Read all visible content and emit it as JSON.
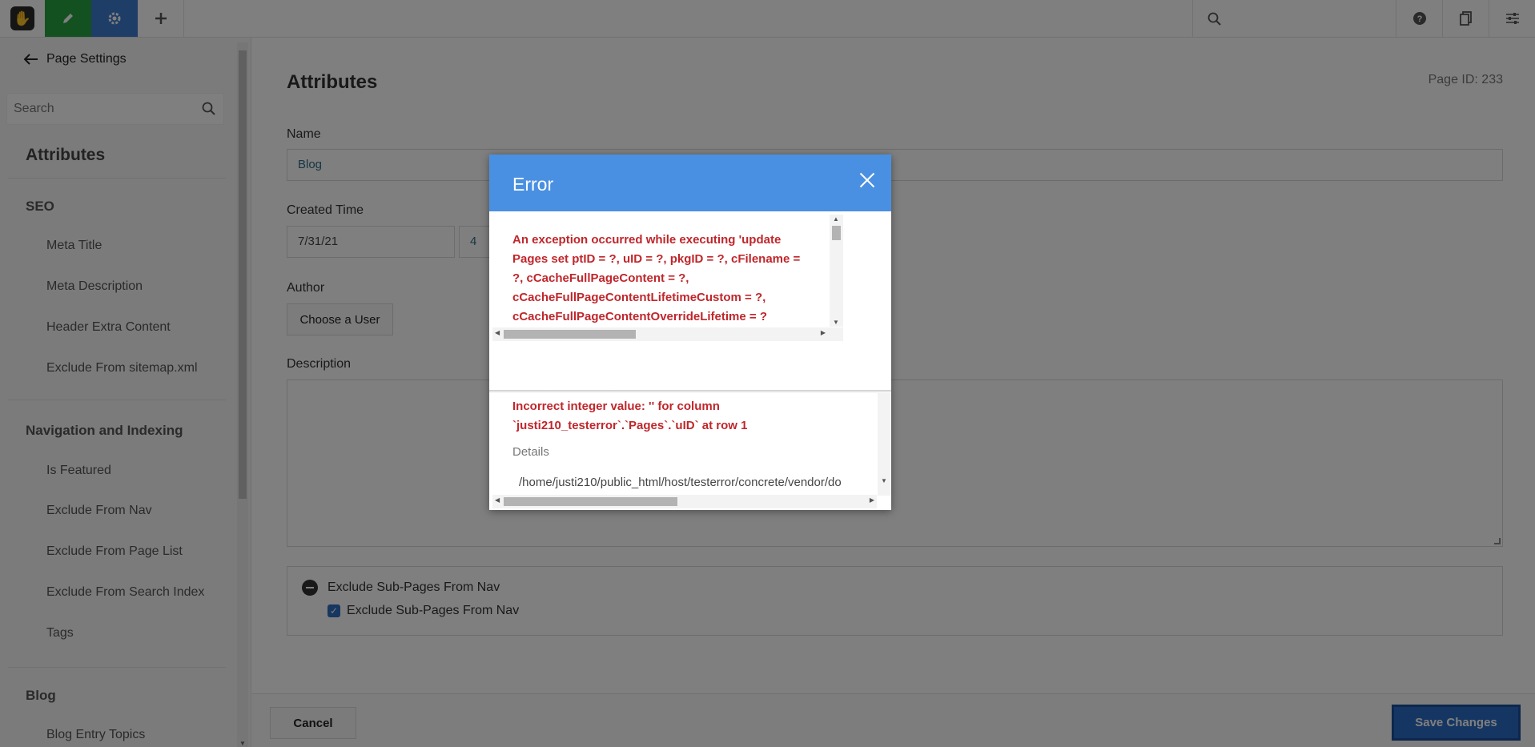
{
  "toolbar": {
    "search_placeholder": "",
    "icons": [
      "concrete-logo-icon",
      "pencil-icon",
      "gear-icon",
      "plus-icon",
      "search-icon",
      "help-icon",
      "pages-icon",
      "sliders-icon"
    ]
  },
  "sidebar": {
    "back_label": "Page Settings",
    "search_placeholder": "Search",
    "title": "Attributes",
    "groups": [
      {
        "label": "SEO",
        "items": [
          "Meta Title",
          "Meta Description",
          "Header Extra Content",
          "Exclude From sitemap.xml"
        ]
      },
      {
        "label": "Navigation and Indexing",
        "items": [
          "Is Featured",
          "Exclude From Nav",
          "Exclude From Page List",
          "Exclude From Search Index",
          "Tags"
        ]
      },
      {
        "label": "Blog",
        "items": [
          "Blog Entry Topics"
        ]
      }
    ]
  },
  "main": {
    "title": "Attributes",
    "page_id": "Page ID: 233",
    "name_label": "Name",
    "name_value": "Blog",
    "created_label": "Created Time",
    "created_date": "7/31/21",
    "created_hour": "4",
    "author_label": "Author",
    "author_button": "Choose a User",
    "description_label": "Description",
    "attribute_header": "Exclude Sub-Pages From Nav",
    "attribute_checkbox": "Exclude Sub-Pages From Nav",
    "cancel_label": "Cancel",
    "save_label": "Save Changes"
  },
  "modal": {
    "title": "Error",
    "exception_text": "An exception occurred while executing 'update Pages set ptID = ?, uID = ?, pkgID = ?, cFilename = ?, cCacheFullPageContent = ?, cCacheFullPageContentLifetimeCustom = ?, cCacheFullPageContentOverrideLifetime = ?",
    "incorrect_text": "Incorrect integer value: '' for column `justi210_testerror`.`Pages`.`uID` at row 1",
    "details_label": "Details",
    "path_text": "/home/justi210/public_html/host/testerror/concrete/vendor/do"
  },
  "colors": {
    "edit_green": "#26a243",
    "settings_blue": "#3d7bce",
    "modal_header": "#4a90e2",
    "error_red": "#c0262b",
    "save_blue": "#2b6cc4"
  }
}
